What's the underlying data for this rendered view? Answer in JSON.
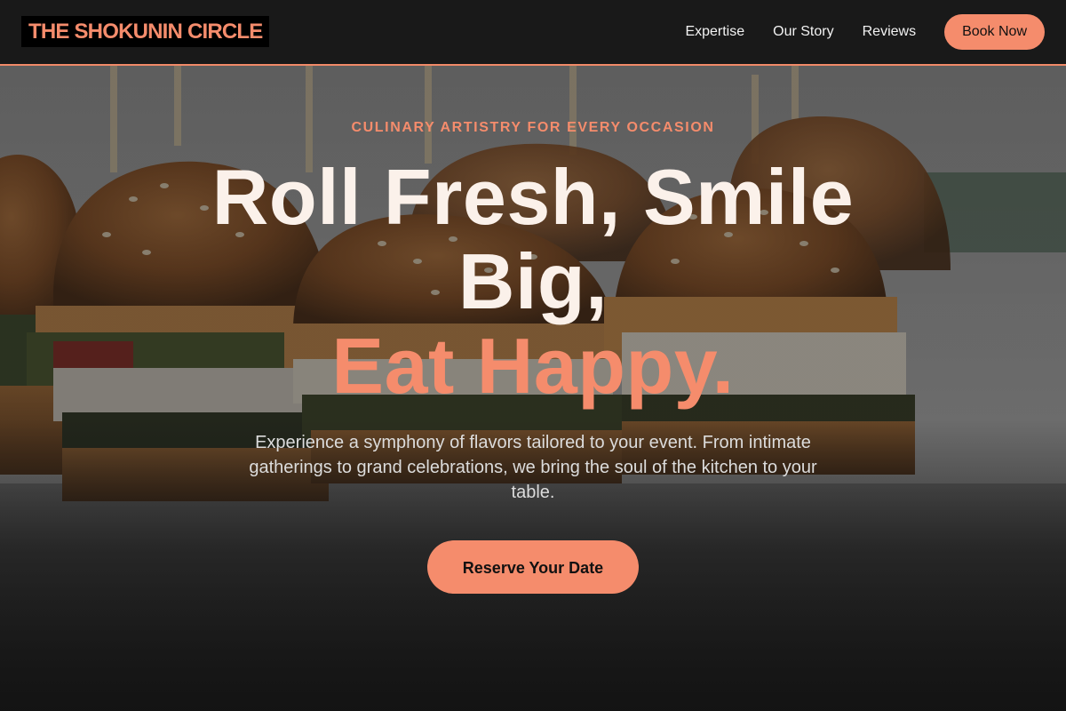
{
  "brand": {
    "logo_text": "THE SHOKUNIN CIRCLE"
  },
  "nav": {
    "links": [
      {
        "label": "Expertise"
      },
      {
        "label": "Our Story"
      },
      {
        "label": "Reviews"
      }
    ],
    "cta_label": "Book Now"
  },
  "hero": {
    "eyebrow": "CULINARY ARTISTRY FOR EVERY OCCASION",
    "headline_line1": "Roll Fresh, Smile Big,",
    "headline_accent": "Eat Happy.",
    "subtext": "Experience a symphony of flavors tailored to your event. From intimate gatherings to grand celebrations, we bring the soul of the kitchen to your table.",
    "cta_label": "Reserve Your Date",
    "background_image": "slider-burgers-photo"
  },
  "colors": {
    "accent": "#f58c6c",
    "header_bg": "#191919",
    "headline_text": "#fbf1ea",
    "page_bg": "#161616"
  }
}
